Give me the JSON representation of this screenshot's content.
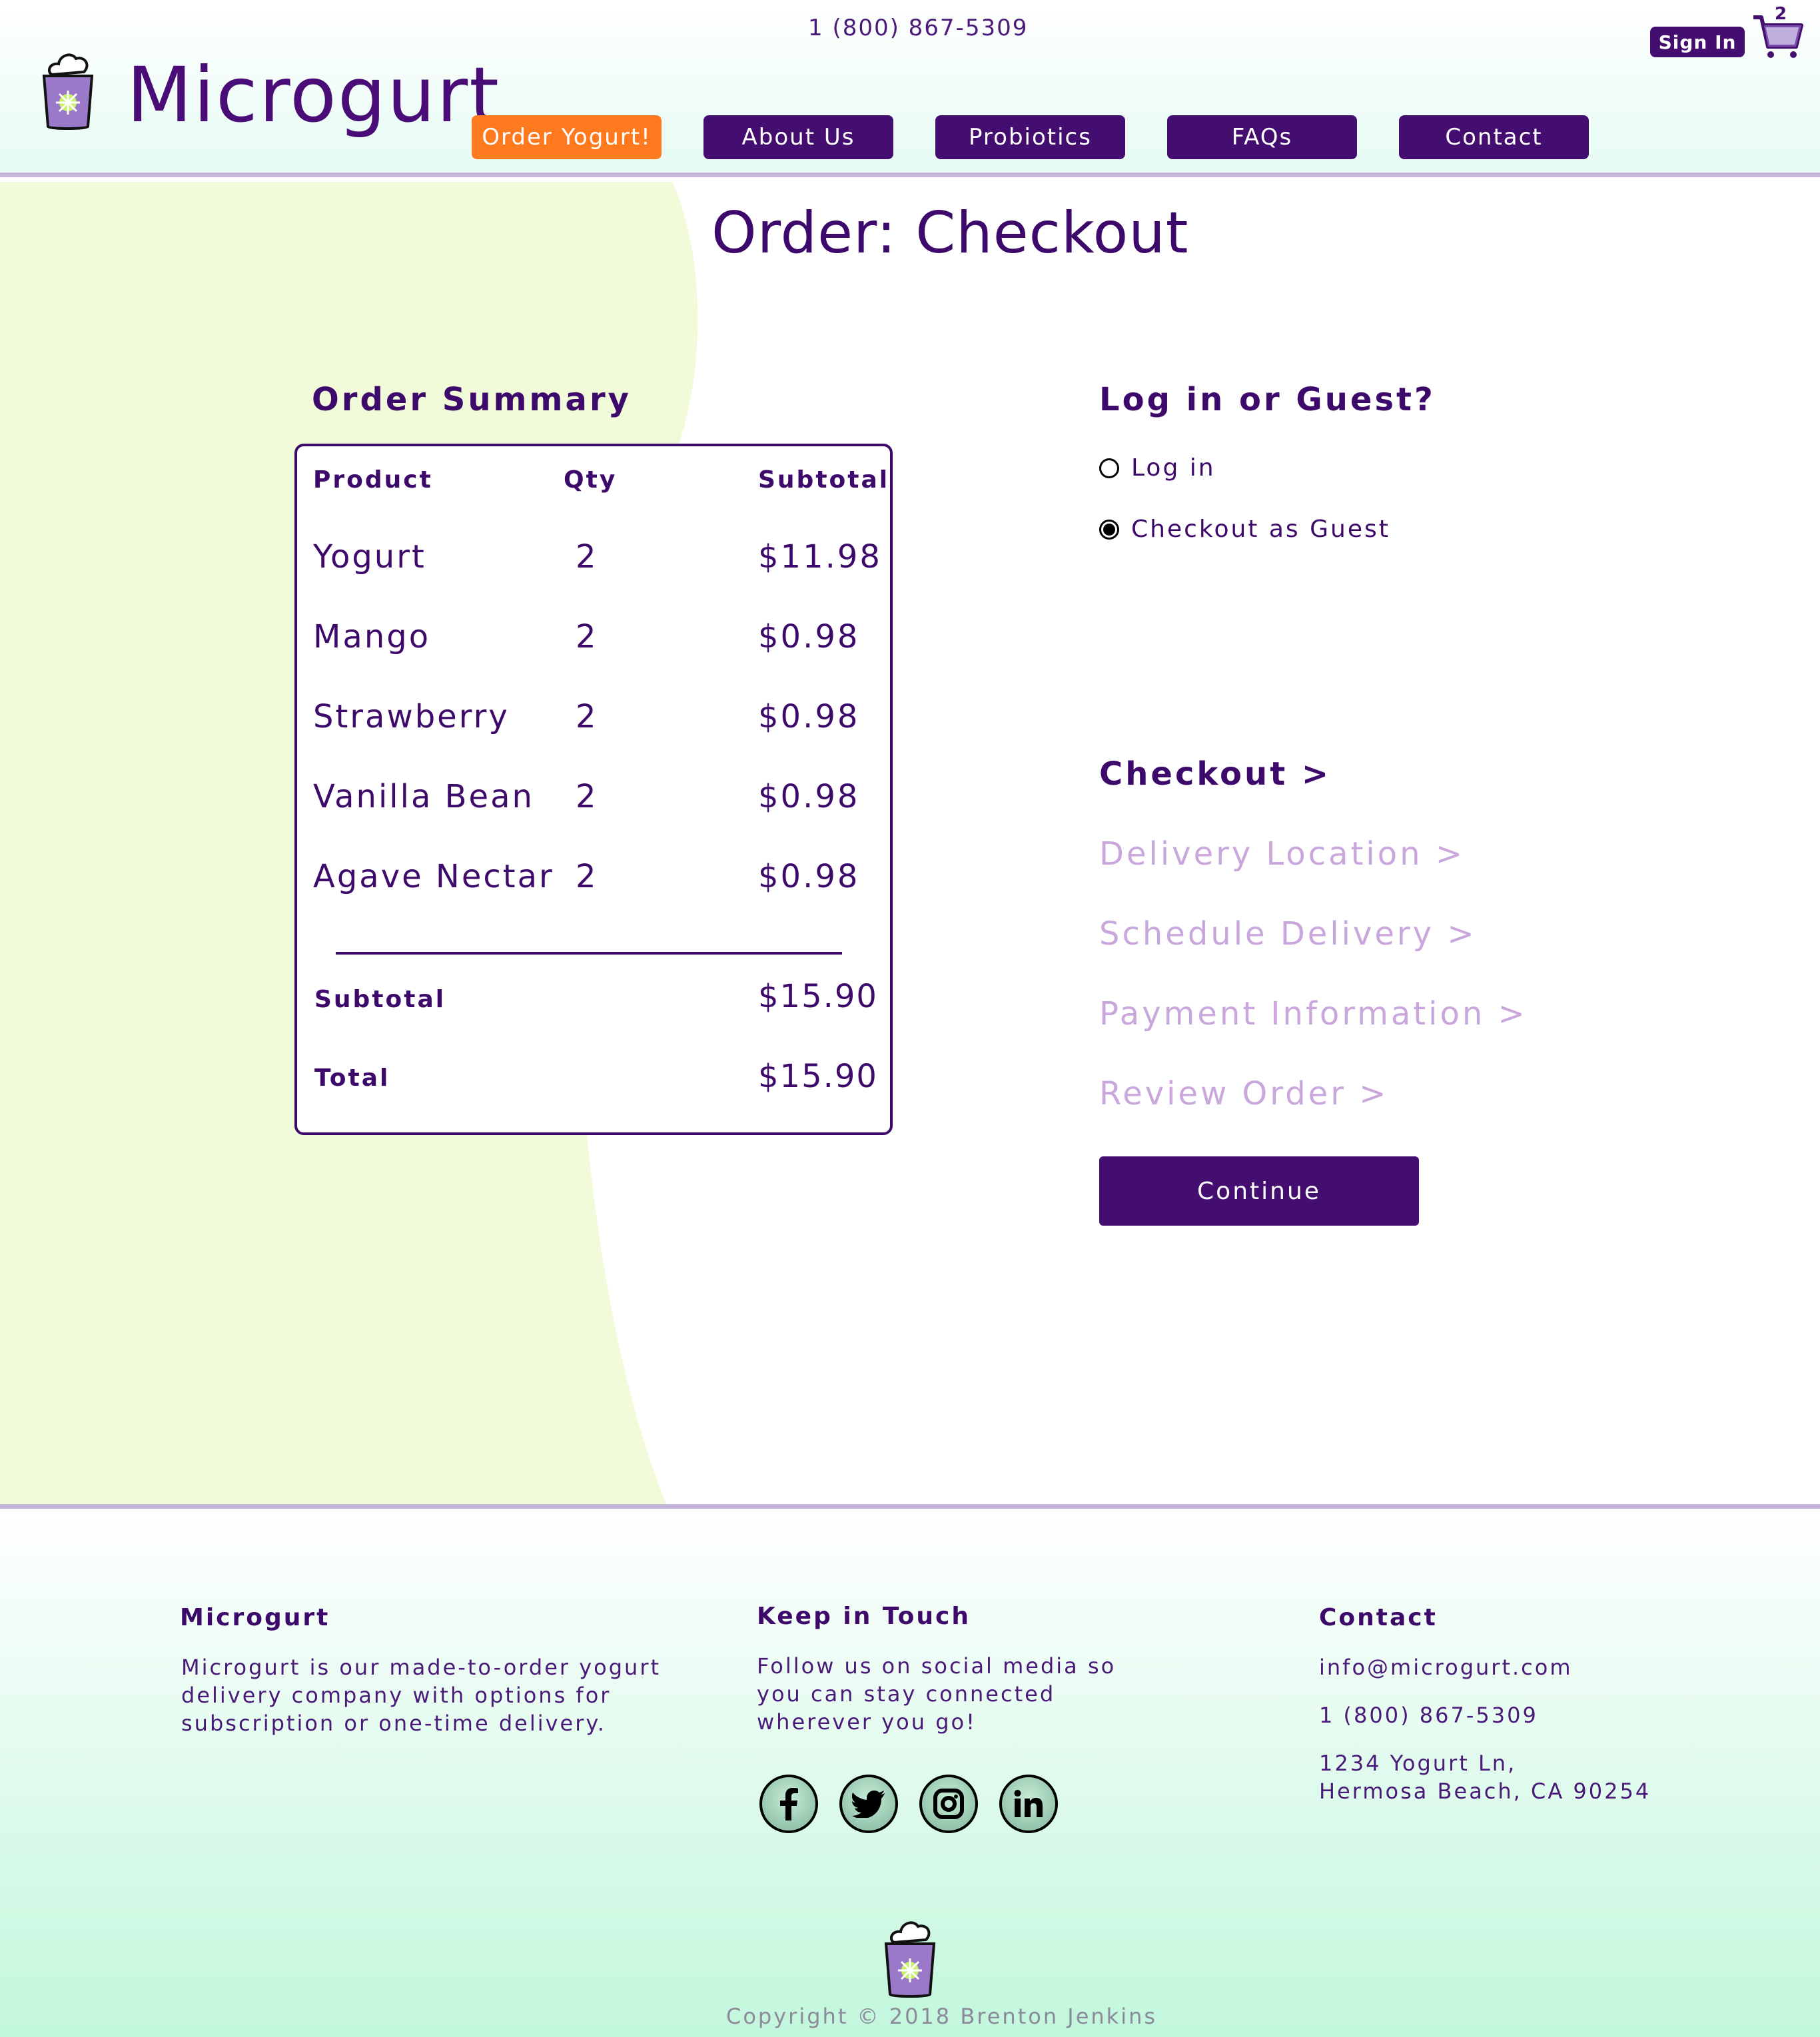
{
  "header": {
    "phone": "1 (800) 867-5309",
    "brand": "Microgurt",
    "nav": [
      "Order Yogurt!",
      "About Us",
      "Probiotics",
      "FAQs",
      "Contact"
    ],
    "sign_in": "Sign In",
    "cart_count": "2"
  },
  "main": {
    "title": "Order: Checkout",
    "summary": {
      "heading": "Order Summary",
      "columns": [
        "Product",
        "Qty",
        "Subtotal"
      ],
      "rows": [
        {
          "product": "Yogurt",
          "qty": "2",
          "subtotal": "$11.98"
        },
        {
          "product": "Mango",
          "qty": "2",
          "subtotal": "$0.98"
        },
        {
          "product": "Strawberry",
          "qty": "2",
          "subtotal": "$0.98"
        },
        {
          "product": "Vanilla Bean",
          "qty": "2",
          "subtotal": "$0.98"
        },
        {
          "product": "Agave Nectar",
          "qty": "2",
          "subtotal": "$0.98"
        }
      ],
      "subtotal_label": "Subtotal",
      "subtotal_value": "$15.90",
      "total_label": "Total",
      "total_value": "$15.90"
    },
    "login": {
      "heading": "Log in or Guest?",
      "options": [
        {
          "label": "Log in",
          "checked": false
        },
        {
          "label": "Checkout as Guest",
          "checked": true
        }
      ]
    },
    "steps": [
      {
        "label": "Checkout >",
        "state": "current"
      },
      {
        "label": "Delivery Location >",
        "state": "pending"
      },
      {
        "label": "Schedule Delivery >",
        "state": "pending"
      },
      {
        "label": "Payment Information >",
        "state": "pending"
      },
      {
        "label": "Review Order >",
        "state": "pending"
      }
    ],
    "continue_label": "Continue"
  },
  "footer": {
    "about_heading": "Microgurt",
    "about_text": [
      "Microgurt is our made-to-order yogurt",
      "delivery company with options for",
      "subscription or one-time delivery."
    ],
    "social_heading": "Keep in Touch",
    "social_text": [
      "Follow us on social media so",
      "you can stay connected",
      "wherever you go!"
    ],
    "social_icons": [
      "facebook-icon",
      "twitter-icon",
      "instagram-icon",
      "linkedin-icon"
    ],
    "contact_heading": "Contact",
    "email": "info@microgurt.com",
    "phone": "1 (800) 867-5309",
    "address_line1": "1234 Yogurt Ln,",
    "address_line2": "Hermosa Beach, CA 90254",
    "copyright": "Copyright © 2018 Brenton Jenkins"
  },
  "colors": {
    "primary": "#440d70",
    "accent": "#ff7a1f",
    "pending_step": "#c9a7dd",
    "blob": "#f2fbd9"
  }
}
